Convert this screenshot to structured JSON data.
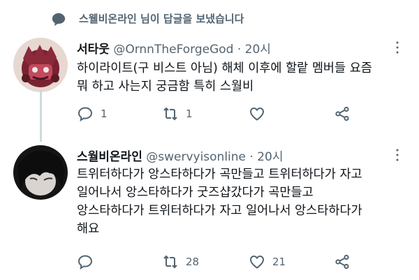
{
  "notice": {
    "text": "스웰비온라인 님이 답글을 보냈습니다"
  },
  "tweets": [
    {
      "name": "서타웃",
      "handle": "@OrnnTheForgeGod",
      "dot": "·",
      "time": "20시",
      "lines": [
        "하이라이트(구 비스트 아님) 해체 이후에 할랕 멤버들 요즘",
        "뭐 하고 사는지 궁금함 특히 스월비"
      ],
      "replies": "1",
      "retweets": "1",
      "likes": ""
    },
    {
      "name": "스월비온라인",
      "handle": "@swervyisonline",
      "dot": "·",
      "time": "20시",
      "lines": [
        "트위터하다가 앙스타하다가 곡만들고 트위터하다가 자고",
        "일어나서 앙스타하다가 굿즈샵갔다가 곡만들고",
        "앙스타하다가 트위터하다가 자고 일어나서 앙스타하다가",
        "해요"
      ],
      "replies": "",
      "retweets": "28",
      "likes": "21"
    }
  ],
  "icons": [
    "speech-bubble-icon",
    "more-icon",
    "reply-icon",
    "retweet-icon",
    "like-icon",
    "share-icon"
  ]
}
